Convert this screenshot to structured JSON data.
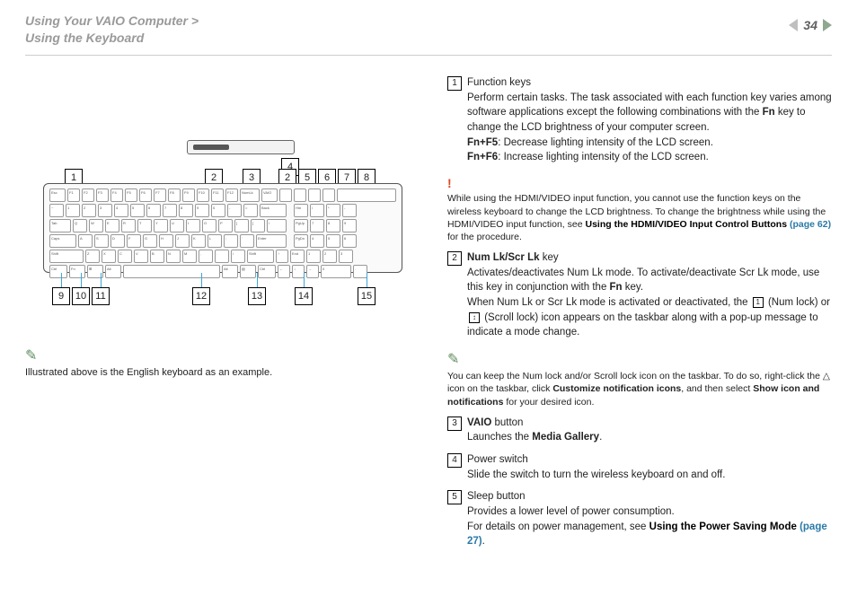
{
  "header": {
    "line1": "Using Your VAIO Computer >",
    "line2": "Using the Keyboard",
    "page": "34"
  },
  "left": {
    "note": "Illustrated above is the English keyboard as an example.",
    "callouts_top": [
      "4"
    ],
    "callouts_row1": [
      "1",
      "2",
      "3",
      "2",
      "5",
      "6",
      "7",
      "8"
    ],
    "callouts_row2": [
      "9",
      "10",
      "11",
      "12",
      "13",
      "14",
      "15"
    ]
  },
  "right": {
    "item1_label": "1",
    "item1_title": "Function keys",
    "item1_body1": "Perform certain tasks. The task associated with each function key varies among software applications except the following combinations with the ",
    "item1_fn": "Fn",
    "item1_body2": " key to change the LCD brightness of your computer screen.",
    "item1_f5": "Fn+F5",
    "item1_f5b": ": Decrease lighting intensity of the LCD screen.",
    "item1_f6": "Fn+F6",
    "item1_f6b": ": Increase lighting intensity of the LCD screen.",
    "warn": "!",
    "warn_body1": "While using the HDMI/VIDEO input function, you cannot use the function keys on the wireless keyboard to change the LCD brightness. To change the brightness while using the HDMI/VIDEO input function, see ",
    "warn_link": "Using the HDMI/VIDEO Input Control Buttons (page 62)",
    "warn_body2": " for the procedure.",
    "item2_label": "2",
    "item2_title": "Num Lk/Scr Lk",
    "item2_title2": " key",
    "item2_body1": "Activates/deactivates Num Lk mode. To activate/deactivate Scr Lk mode, use this key in conjunction with the ",
    "item2_fn": "Fn",
    "item2_body2": " key.",
    "item2_body3": "When Num Lk or Scr Lk mode is activated or deactivated, the ",
    "item2_numlock": "1",
    "item2_body4": " (Num lock) or ",
    "item2_scrlock": "↕",
    "item2_body5": " (Scroll lock) icon appears on the taskbar along with a pop-up message to indicate a mode change.",
    "note2_body1": "You can keep the Num lock and/or Scroll lock icon on the taskbar. To do so, right-click the △ icon on the taskbar, click ",
    "note2_b1": "Customize notification icons",
    "note2_body2": ", and then select ",
    "note2_b2": "Show icon and notifications",
    "note2_body3": " for your desired icon.",
    "item3_label": "3",
    "item3_title": "VAIO",
    "item3_title2": " button",
    "item3_body": "Launches the ",
    "item3_b": "Media Gallery",
    "item4_label": "4",
    "item4_title": "Power switch",
    "item4_body": "Slide the switch to turn the wireless keyboard on and off.",
    "item5_label": "5",
    "item5_title": "Sleep button",
    "item5_body1": "Provides a lower level of power consumption.",
    "item5_body2": "For details on power management, see ",
    "item5_link": "Using the Power Saving Mode (page 27)"
  }
}
